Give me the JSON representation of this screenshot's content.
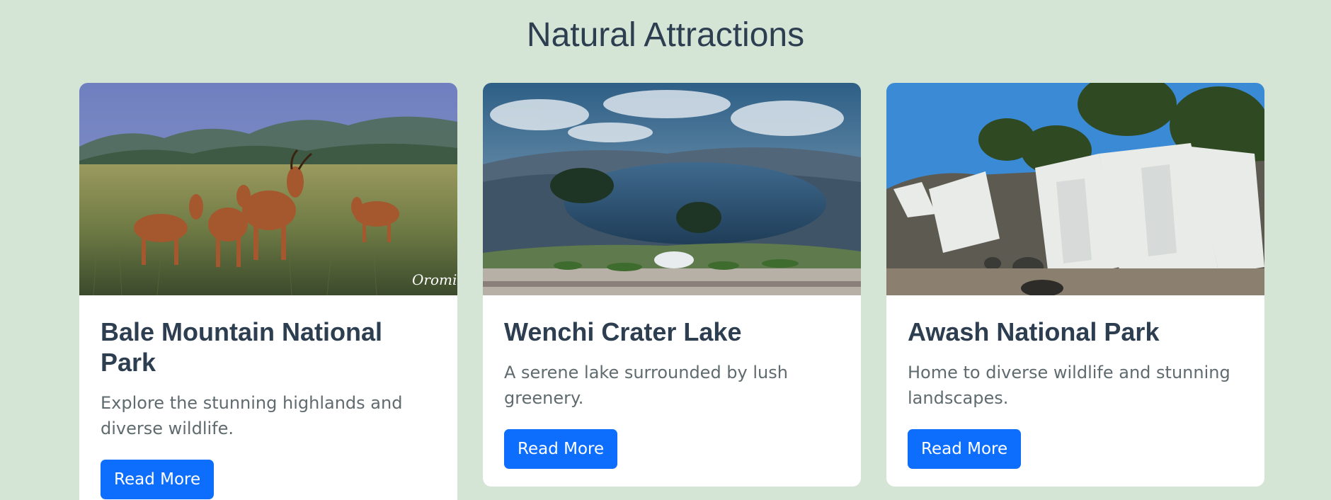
{
  "section": {
    "title": "Natural Attractions"
  },
  "cards": [
    {
      "title": "Bale Mountain National Park",
      "description": "Explore the stunning highlands and diverse wildlife.",
      "button_label": "Read More",
      "image_alt": "Bale Mountain National Park",
      "watermark": "Oromia"
    },
    {
      "title": "Wenchi Crater Lake",
      "description": "A serene lake surrounded by lush greenery.",
      "button_label": "Read More",
      "image_alt": "Wenchi Crater Lake"
    },
    {
      "title": "Awash National Park",
      "description": "Home to diverse wildlife and stunning landscapes.",
      "button_label": "Read More",
      "image_alt": "Awash National Park"
    }
  ],
  "colors": {
    "background": "#d5e5d5",
    "heading": "#2c3e50",
    "text": "#5f6b6e",
    "button": "#0d6efd"
  }
}
